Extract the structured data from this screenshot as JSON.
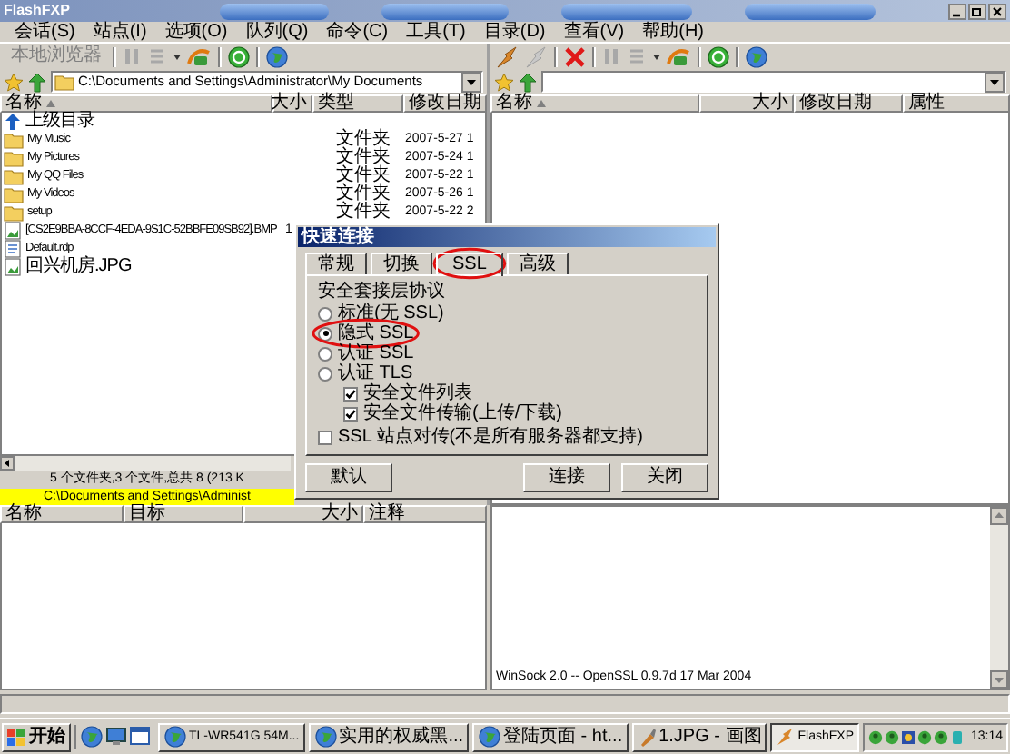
{
  "window": {
    "title": "FlashFXP"
  },
  "menu": [
    "会话(S)",
    "站点(I)",
    "选项(O)",
    "队列(Q)",
    "命令(C)",
    "工具(T)",
    "目录(D)",
    "查看(V)",
    "帮助(H)"
  ],
  "left_pane": {
    "mode_label": "本地浏览器",
    "path": "C:\\Documents and Settings\\Administrator\\My Documents",
    "columns": [
      "名称",
      "大小",
      "类型",
      "修改日期"
    ],
    "rows": [
      {
        "kind": "up",
        "name": "上级目录"
      },
      {
        "kind": "folder",
        "name": "My Music",
        "type": "文件夹",
        "date": "2007-5-27 1"
      },
      {
        "kind": "folder",
        "name": "My Pictures",
        "type": "文件夹",
        "date": "2007-5-24 1"
      },
      {
        "kind": "folder",
        "name": "My QQ Files",
        "type": "文件夹",
        "date": "2007-5-22 1"
      },
      {
        "kind": "folder",
        "name": "My Videos",
        "type": "文件夹",
        "date": "2007-5-26 1"
      },
      {
        "kind": "folder",
        "name": "setup",
        "type": "文件夹",
        "date": "2007-5-22 2"
      },
      {
        "kind": "image",
        "name": "[CS2E9BBA-8CCF-4EDA-9S1C-52BBFE09SB92].BMP",
        "size": "1"
      },
      {
        "kind": "document",
        "name": "Default.rdp"
      },
      {
        "kind": "image",
        "name": "回兴机房.JPG"
      }
    ],
    "summary": "5 个文件夹,3 个文件,总共 8 (213 K",
    "path_status": "C:\\Documents and Settings\\Administ"
  },
  "right_pane": {
    "columns": [
      "名称",
      "大小",
      "修改日期",
      "属性"
    ]
  },
  "dialog": {
    "title": "快速连接",
    "tabs": [
      {
        "label": "常规",
        "selected": false,
        "circled": false
      },
      {
        "label": "切换",
        "selected": false,
        "circled": false
      },
      {
        "label": "SSL",
        "selected": true,
        "circled": true
      },
      {
        "label": "高级",
        "selected": false,
        "circled": false
      }
    ],
    "group_label": "安全套接层协议",
    "options": [
      {
        "label": "标准(无 SSL)",
        "selected": false,
        "circled": false
      },
      {
        "label": "隐式 SSL",
        "selected": true,
        "circled": true
      },
      {
        "label": "认证 SSL",
        "selected": false,
        "circled": false
      },
      {
        "label": "认证 TLS",
        "selected": false,
        "circled": false,
        "children": [
          {
            "label": "安全文件列表",
            "checked": true
          },
          {
            "label": "安全文件传输(上传/下载)",
            "checked": true
          }
        ]
      }
    ],
    "site_to_site": {
      "label": "SSL 站点对传(不是所有服务器都支持)",
      "checked": false
    },
    "buttons_left": [
      "默认"
    ],
    "buttons_right": [
      "连接",
      "关闭"
    ]
  },
  "queue": {
    "columns": [
      "名称",
      "目标",
      "大小",
      "注释"
    ]
  },
  "log": {
    "lines": [
      "WinSock 2.0 -- OpenSSL 0.9.7d 17 Mar 2004"
    ]
  },
  "taskbar": {
    "start": "开始",
    "windows": [
      {
        "kind": "browser",
        "label": "TL-WR541G 54M...",
        "selected": false
      },
      {
        "kind": "browser",
        "label": "实用的权威黑...",
        "selected": false
      },
      {
        "kind": "browser",
        "label": "登陆页面 - ht...",
        "selected": false
      },
      {
        "kind": "paint",
        "label": "1.JPG - 画图",
        "selected": false
      },
      {
        "kind": "ftp",
        "label": "FlashFXP",
        "selected": true
      }
    ],
    "clock": "13:14"
  }
}
